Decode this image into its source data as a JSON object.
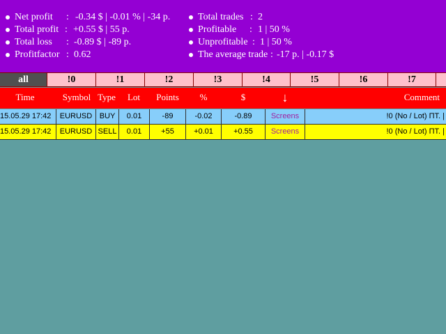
{
  "colors": {
    "summary_bg": "#9400d3",
    "tab_bg": "#ffc0cb",
    "tab_active_bg": "#505050",
    "header_bg": "#ff0000",
    "row_buy_bg": "#87cefa",
    "row_sell_bg": "#ffff00",
    "page_bg": "#5f9ea0",
    "link_color": "#a020a0"
  },
  "summary": {
    "left": [
      {
        "label": "Net profit",
        "value": "-0.34 $ | -0.01 % | -34 p."
      },
      {
        "label": "Total profit",
        "value": "+0.55 $ | 55 p."
      },
      {
        "label": "Total loss",
        "value": "-0.89 $ | -89 p."
      },
      {
        "label": "Profitfactor",
        "value": "0.62"
      }
    ],
    "right": [
      {
        "label": "Total trades",
        "value": "2"
      },
      {
        "label": "Profitable",
        "value": "1 | 50 %"
      },
      {
        "label": "Unprofitable",
        "value": "1 | 50 %"
      },
      {
        "label": "The average trade",
        "value": "-17 p. | -0.17 $"
      }
    ],
    "separator": ":"
  },
  "tabs": [
    {
      "label": "all",
      "active": true
    },
    {
      "label": "!0"
    },
    {
      "label": "!1"
    },
    {
      "label": "!2"
    },
    {
      "label": "!3"
    },
    {
      "label": "!4"
    },
    {
      "label": "!5"
    },
    {
      "label": "!6"
    },
    {
      "label": "!7"
    }
  ],
  "table": {
    "headers": {
      "time": "Time",
      "symbol": "Symbol",
      "type": "Type",
      "lot": "Lot",
      "points": "Points",
      "percent": "%",
      "dollar": "$",
      "sort_arrow": "↓",
      "comment": "Comment"
    },
    "rows": [
      {
        "time": "15.05.29 17:42",
        "symbol": "EURUSD",
        "type": "BUY",
        "lot": "0.01",
        "points": "-89",
        "percent": "-0.02",
        "dollar": "-0.89",
        "screens": "Screens",
        "comment": "!0 (No / Lot) ПТ. |"
      },
      {
        "time": "15.05.29 17:42",
        "symbol": "EURUSD",
        "type": "SELL",
        "lot": "0.01",
        "points": "+55",
        "percent": "+0.01",
        "dollar": "+0.55",
        "screens": "Screens",
        "comment": "!0 (No / Lot) ПТ. |"
      }
    ]
  }
}
